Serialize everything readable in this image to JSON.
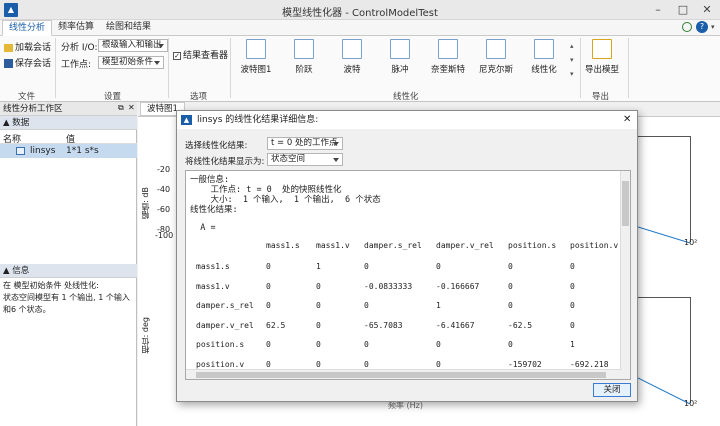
{
  "window": {
    "title": "模型线性化器 - ControlModelTest",
    "help_glyph": "?"
  },
  "tabs": [
    "线性分析",
    "频率估算",
    "绘图和结果"
  ],
  "ribbon": {
    "file": {
      "load": "加载会话",
      "save": "保存会话",
      "group": "文件"
    },
    "setup": {
      "io_label": "分析 I/O:",
      "io_value": "根级输入和输出",
      "op_label": "工作点:",
      "op_value": "模型初始条件",
      "group": "设置"
    },
    "options": {
      "result_viewer": "结果查看器",
      "group": "选项"
    },
    "linearize": {
      "buttons": [
        "波特图1",
        "阶跃",
        "波特",
        "脉冲",
        "奈奎斯特",
        "尼克尔斯",
        "线性化"
      ],
      "group": "线性化"
    },
    "export": {
      "label": "导出模型",
      "group": "导出"
    }
  },
  "left_panel": {
    "title": "线性分析工作区",
    "data_section": "数据",
    "col_name": "名称",
    "col_value": "值",
    "row_name": "linsys",
    "row_value": "1*1 s*s",
    "info_section": "信息",
    "info_text": "在 模型初始条件 处线性化:\n状态空间模型有 1 个输出, 1 个输入和6 个状态。"
  },
  "plot": {
    "tab": "波特图1",
    "ylabel_top": "幅值: dB",
    "yticks_top": [
      "-20",
      "-40",
      "-60",
      "-80",
      "-100"
    ],
    "ylabel_bottom": "相位: deg",
    "xtick": "10²",
    "xlabel_partial": "频率 (Hz)"
  },
  "dialog": {
    "title": "linsys 的线性化结果详细信息:",
    "select_label": "选择线性化结果:",
    "select_value": "t = 0 处的工作点",
    "display_label": "将线性化结果显示为:",
    "display_value": "状态空间",
    "text_lines": [
      "一般信息:",
      "    工作点: t = 0  处的快照线性化",
      "    大小:  1 个输入,  1 个输出,  6 个状态",
      "线性化结果:",
      "",
      "  A ="
    ],
    "matrix": {
      "columns": [
        "mass1.s",
        "mass1.v",
        "damper.s_rel",
        "damper.v_rel",
        "position.s",
        "position.v"
      ],
      "rows": [
        {
          "name": "mass1.s",
          "values": [
            "0",
            "1",
            "0",
            "0",
            "0",
            "0"
          ]
        },
        {
          "name": "mass1.v",
          "values": [
            "0",
            "0",
            "-0.0833333",
            "-0.166667",
            "0",
            "0"
          ]
        },
        {
          "name": "damper.s_rel",
          "values": [
            "0",
            "0",
            "0",
            "1",
            "0",
            "0"
          ]
        },
        {
          "name": "damper.v_rel",
          "values": [
            "62.5",
            "0",
            "-65.7083",
            "-6.41667",
            "-62.5",
            "0"
          ]
        },
        {
          "name": "position.s",
          "values": [
            "0",
            "0",
            "0",
            "0",
            "0",
            "1"
          ]
        },
        {
          "name": "position.v",
          "values": [
            "0",
            "0",
            "0",
            "0",
            "-159702",
            "-692.218"
          ]
        }
      ]
    },
    "close": "关闭"
  }
}
